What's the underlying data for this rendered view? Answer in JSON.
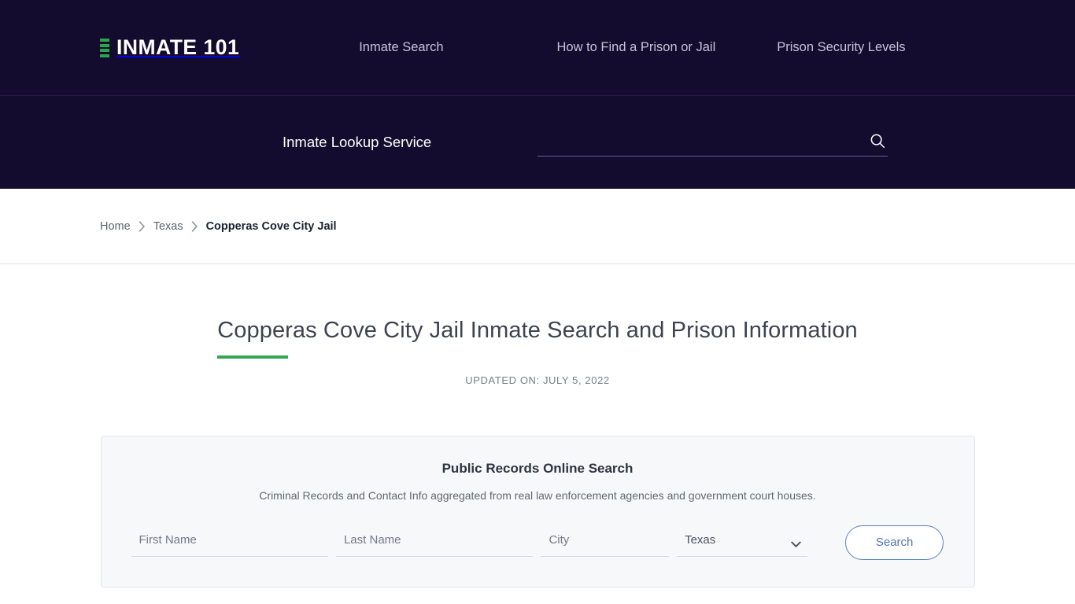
{
  "brand": {
    "name": "INMATE 101",
    "mark_color": "#2fa34b"
  },
  "nav": {
    "items": [
      {
        "label": "Inmate Search"
      },
      {
        "label": "How to Find a Prison or Jail"
      },
      {
        "label": "Prison Security Levels"
      }
    ]
  },
  "search_band": {
    "label": "Inmate Lookup Service",
    "input_value": "",
    "input_placeholder": ""
  },
  "breadcrumb": {
    "items": [
      {
        "label": "Home"
      },
      {
        "label": "Texas"
      }
    ],
    "current": "Copperas Cove City Jail",
    "separator": "›"
  },
  "page": {
    "title": "Copperas Cove City Jail Inmate Search and Prison Information",
    "updated": "UPDATED ON: JULY 5, 2022",
    "accent_color": "#33a852"
  },
  "records_card": {
    "title": "Public Records Online Search",
    "subtitle": "Criminal Records and Contact Info aggregated from real law enforcement agencies and government court houses.",
    "fields": {
      "first_name": {
        "placeholder": "First Name",
        "value": ""
      },
      "last_name": {
        "placeholder": "Last Name",
        "value": ""
      },
      "city": {
        "placeholder": "City",
        "value": ""
      },
      "state": {
        "selected": "Texas",
        "options": [
          "Texas"
        ]
      }
    },
    "submit_label": "Search",
    "submit_color": "#4f74b8"
  }
}
